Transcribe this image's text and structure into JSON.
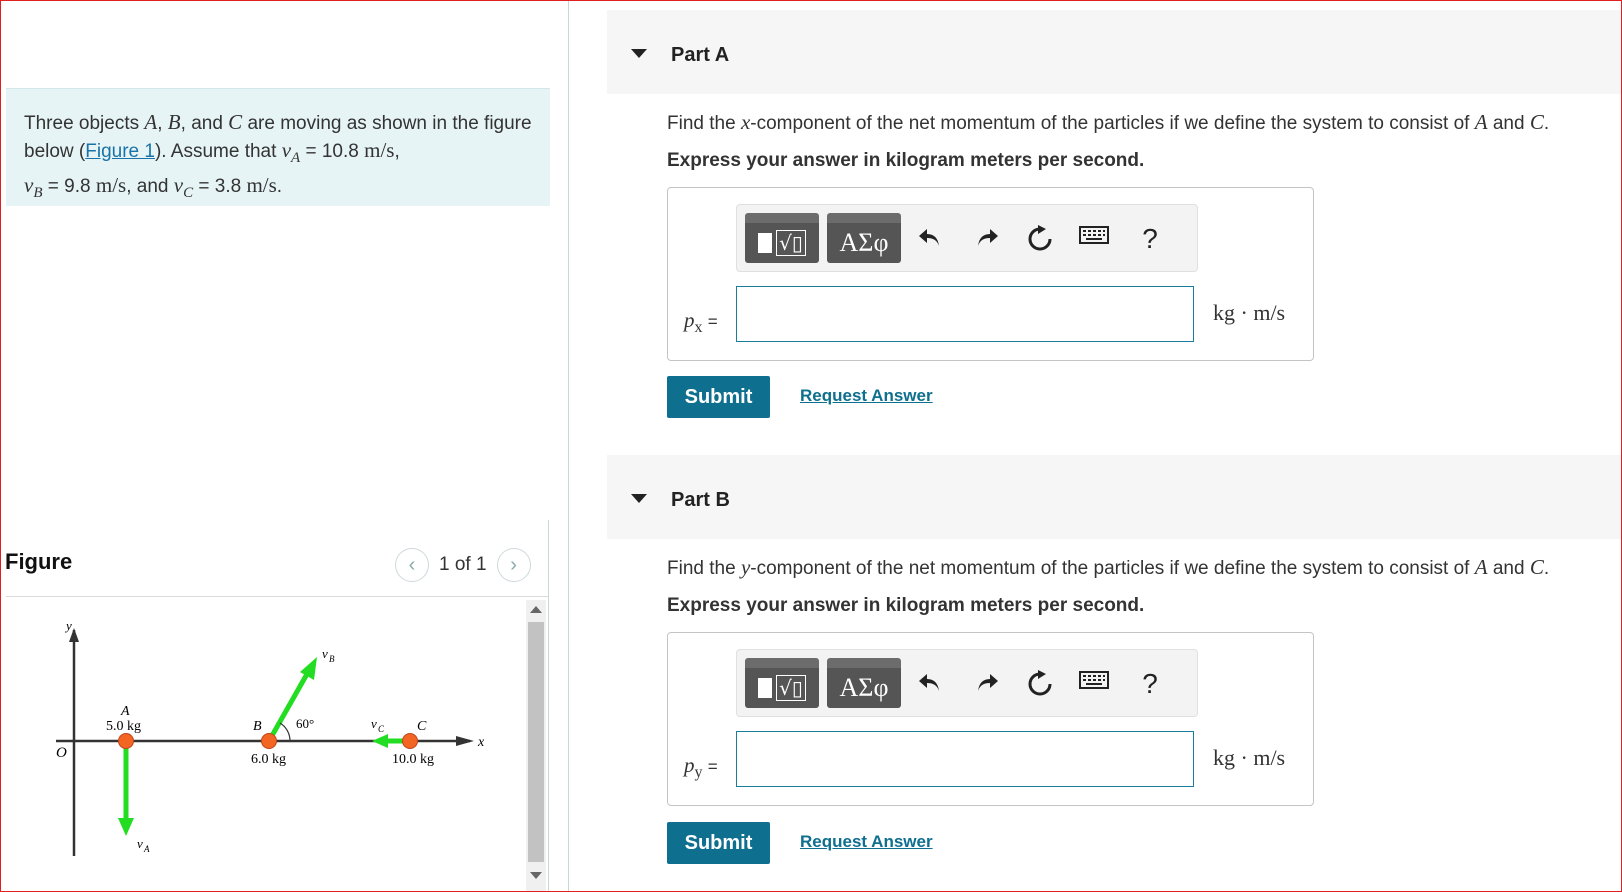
{
  "problem": {
    "intro_pre": "Three objects",
    "obj_a": "A",
    "obj_b": "B",
    "obj_c": "C",
    "comma": ",",
    "and": "and",
    "are_moving": "are moving as shown in the figure below (",
    "figure_link": "Figure 1",
    "assume": "). Assume that",
    "va_sym": "v",
    "va_sub": "A",
    "va_value": "= 10.8",
    "vb_sym": "v",
    "vb_sub": "B",
    "vb_value": "= 9.8",
    "vc_sym": "v",
    "vc_sub": "C",
    "vc_value": "= 3.8",
    "unit": "m/s",
    "and_text": ", and",
    "period": "."
  },
  "figure": {
    "title": "Figure",
    "pager_text": "1 of 1",
    "prev_icon": "chevron-left-icon",
    "next_icon": "chevron-right-icon",
    "labels": {
      "y": "y",
      "x": "x",
      "origin": "O",
      "a": "A",
      "b": "B",
      "c": "C",
      "mass_a": "5.0 kg",
      "mass_b": "6.0 kg",
      "mass_c": "10.0 kg",
      "angle": "60°",
      "va": "v",
      "va_sub": "A",
      "vb": "v",
      "vb_sub": "B",
      "vc": "v",
      "vc_sub": "C"
    },
    "colors": {
      "arrow": "#22dd22",
      "ball": "#f26522"
    }
  },
  "parts": [
    {
      "title": "Part A",
      "question_pre": "Find the",
      "component_var": "x",
      "question_post": "-component of the net momentum of the particles if we define the system to consist of",
      "obj1": "A",
      "and": "and",
      "obj2": "C",
      "period": ".",
      "instruction": "Express your answer in kilogram meters per second.",
      "var_symbol": "p",
      "var_sub": "x",
      "var_eq": "=",
      "input_value": "",
      "unit": "kg · m/s",
      "submit": "Submit",
      "request": "Request Answer"
    },
    {
      "title": "Part B",
      "question_pre": "Find the",
      "component_var": "y",
      "question_post": "-component of the net momentum of the particles if we define the system to consist of",
      "obj1": "A",
      "and": "and",
      "obj2": "C",
      "period": ".",
      "instruction": "Express your answer in kilogram meters per second.",
      "var_symbol": "p",
      "var_sub": "y",
      "var_eq": "=",
      "input_value": "",
      "unit": "kg · m/s",
      "submit": "Submit",
      "request": "Request Answer"
    }
  ],
  "toolbar": {
    "greek_label": "ΑΣφ",
    "help_label": "?",
    "icons": [
      "templates-icon",
      "greek-letters-icon",
      "undo-icon",
      "redo-icon",
      "reset-icon",
      "keyboard-icon",
      "help-icon"
    ]
  },
  "colors": {
    "accent": "#0f6f8f",
    "intro_bg": "#e6f4f5",
    "frame": "#e0201e"
  }
}
